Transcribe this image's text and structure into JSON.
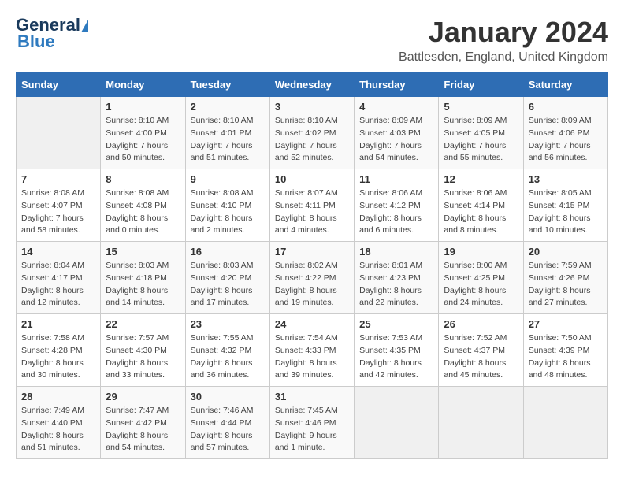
{
  "header": {
    "logo_line1": "General",
    "logo_line2": "Blue",
    "title": "January 2024",
    "subtitle": "Battlesden, England, United Kingdom"
  },
  "days_of_week": [
    "Sunday",
    "Monday",
    "Tuesday",
    "Wednesday",
    "Thursday",
    "Friday",
    "Saturday"
  ],
  "weeks": [
    [
      {
        "day": "",
        "info": ""
      },
      {
        "day": "1",
        "info": "Sunrise: 8:10 AM\nSunset: 4:00 PM\nDaylight: 7 hours\nand 50 minutes."
      },
      {
        "day": "2",
        "info": "Sunrise: 8:10 AM\nSunset: 4:01 PM\nDaylight: 7 hours\nand 51 minutes."
      },
      {
        "day": "3",
        "info": "Sunrise: 8:10 AM\nSunset: 4:02 PM\nDaylight: 7 hours\nand 52 minutes."
      },
      {
        "day": "4",
        "info": "Sunrise: 8:09 AM\nSunset: 4:03 PM\nDaylight: 7 hours\nand 54 minutes."
      },
      {
        "day": "5",
        "info": "Sunrise: 8:09 AM\nSunset: 4:05 PM\nDaylight: 7 hours\nand 55 minutes."
      },
      {
        "day": "6",
        "info": "Sunrise: 8:09 AM\nSunset: 4:06 PM\nDaylight: 7 hours\nand 56 minutes."
      }
    ],
    [
      {
        "day": "7",
        "info": "Sunrise: 8:08 AM\nSunset: 4:07 PM\nDaylight: 7 hours\nand 58 minutes."
      },
      {
        "day": "8",
        "info": "Sunrise: 8:08 AM\nSunset: 4:08 PM\nDaylight: 8 hours\nand 0 minutes."
      },
      {
        "day": "9",
        "info": "Sunrise: 8:08 AM\nSunset: 4:10 PM\nDaylight: 8 hours\nand 2 minutes."
      },
      {
        "day": "10",
        "info": "Sunrise: 8:07 AM\nSunset: 4:11 PM\nDaylight: 8 hours\nand 4 minutes."
      },
      {
        "day": "11",
        "info": "Sunrise: 8:06 AM\nSunset: 4:12 PM\nDaylight: 8 hours\nand 6 minutes."
      },
      {
        "day": "12",
        "info": "Sunrise: 8:06 AM\nSunset: 4:14 PM\nDaylight: 8 hours\nand 8 minutes."
      },
      {
        "day": "13",
        "info": "Sunrise: 8:05 AM\nSunset: 4:15 PM\nDaylight: 8 hours\nand 10 minutes."
      }
    ],
    [
      {
        "day": "14",
        "info": "Sunrise: 8:04 AM\nSunset: 4:17 PM\nDaylight: 8 hours\nand 12 minutes."
      },
      {
        "day": "15",
        "info": "Sunrise: 8:03 AM\nSunset: 4:18 PM\nDaylight: 8 hours\nand 14 minutes."
      },
      {
        "day": "16",
        "info": "Sunrise: 8:03 AM\nSunset: 4:20 PM\nDaylight: 8 hours\nand 17 minutes."
      },
      {
        "day": "17",
        "info": "Sunrise: 8:02 AM\nSunset: 4:22 PM\nDaylight: 8 hours\nand 19 minutes."
      },
      {
        "day": "18",
        "info": "Sunrise: 8:01 AM\nSunset: 4:23 PM\nDaylight: 8 hours\nand 22 minutes."
      },
      {
        "day": "19",
        "info": "Sunrise: 8:00 AM\nSunset: 4:25 PM\nDaylight: 8 hours\nand 24 minutes."
      },
      {
        "day": "20",
        "info": "Sunrise: 7:59 AM\nSunset: 4:26 PM\nDaylight: 8 hours\nand 27 minutes."
      }
    ],
    [
      {
        "day": "21",
        "info": "Sunrise: 7:58 AM\nSunset: 4:28 PM\nDaylight: 8 hours\nand 30 minutes."
      },
      {
        "day": "22",
        "info": "Sunrise: 7:57 AM\nSunset: 4:30 PM\nDaylight: 8 hours\nand 33 minutes."
      },
      {
        "day": "23",
        "info": "Sunrise: 7:55 AM\nSunset: 4:32 PM\nDaylight: 8 hours\nand 36 minutes."
      },
      {
        "day": "24",
        "info": "Sunrise: 7:54 AM\nSunset: 4:33 PM\nDaylight: 8 hours\nand 39 minutes."
      },
      {
        "day": "25",
        "info": "Sunrise: 7:53 AM\nSunset: 4:35 PM\nDaylight: 8 hours\nand 42 minutes."
      },
      {
        "day": "26",
        "info": "Sunrise: 7:52 AM\nSunset: 4:37 PM\nDaylight: 8 hours\nand 45 minutes."
      },
      {
        "day": "27",
        "info": "Sunrise: 7:50 AM\nSunset: 4:39 PM\nDaylight: 8 hours\nand 48 minutes."
      }
    ],
    [
      {
        "day": "28",
        "info": "Sunrise: 7:49 AM\nSunset: 4:40 PM\nDaylight: 8 hours\nand 51 minutes."
      },
      {
        "day": "29",
        "info": "Sunrise: 7:47 AM\nSunset: 4:42 PM\nDaylight: 8 hours\nand 54 minutes."
      },
      {
        "day": "30",
        "info": "Sunrise: 7:46 AM\nSunset: 4:44 PM\nDaylight: 8 hours\nand 57 minutes."
      },
      {
        "day": "31",
        "info": "Sunrise: 7:45 AM\nSunset: 4:46 PM\nDaylight: 9 hours\nand 1 minute."
      },
      {
        "day": "",
        "info": ""
      },
      {
        "day": "",
        "info": ""
      },
      {
        "day": "",
        "info": ""
      }
    ]
  ]
}
